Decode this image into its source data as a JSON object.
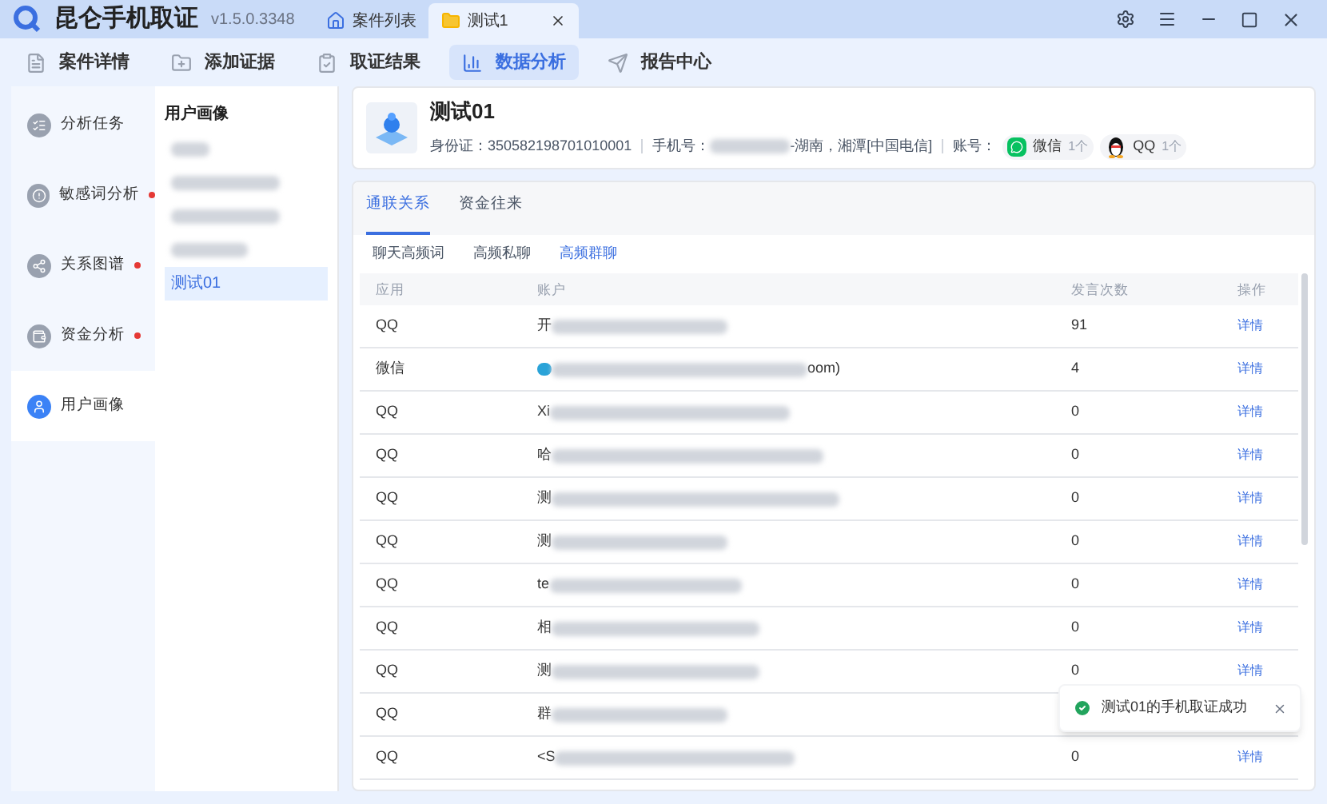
{
  "app": {
    "name": "昆仑手机取证",
    "version": "v1.5.0.3348"
  },
  "tabs": [
    {
      "label": "案件列表",
      "selected": false,
      "closable": false
    },
    {
      "label": "测试1",
      "selected": true,
      "closable": true
    }
  ],
  "toolbar": [
    {
      "label": "案件详情",
      "selected": false
    },
    {
      "label": "添加证据",
      "selected": false
    },
    {
      "label": "取证结果",
      "selected": false
    },
    {
      "label": "数据分析",
      "selected": true
    },
    {
      "label": "报告中心",
      "selected": false
    }
  ],
  "nav": [
    {
      "label": "分析任务",
      "dot": false,
      "selected": false
    },
    {
      "label": "敏感词分析",
      "dot": true,
      "selected": false
    },
    {
      "label": "关系图谱",
      "dot": true,
      "selected": false
    },
    {
      "label": "资金分析",
      "dot": true,
      "selected": false
    },
    {
      "label": "用户画像",
      "dot": false,
      "selected": true
    }
  ],
  "list": {
    "title": "用户画像",
    "items": [
      {
        "kind": "blurred",
        "selected": false
      },
      {
        "kind": "blurred",
        "selected": false
      },
      {
        "kind": "blurred",
        "selected": false
      },
      {
        "kind": "blurred",
        "selected": false
      },
      {
        "kind": "text",
        "label": "测试01",
        "selected": true
      }
    ]
  },
  "profile": {
    "name": "测试01",
    "id": "身份证：350582198701010001",
    "phone_label": "手机号：",
    "phone_suffix": "-湖南，湘潭[中国电信]",
    "account_label": "账号：",
    "accounts": [
      {
        "kind": "wechat",
        "name": "微信",
        "count": "1个"
      },
      {
        "kind": "qq",
        "name": "QQ",
        "count": "1个"
      }
    ]
  },
  "main_tabs": [
    {
      "label": "通联关系",
      "selected": true
    },
    {
      "label": "资金往来",
      "selected": false
    }
  ],
  "sub_tabs": [
    {
      "label": "聊天高频词",
      "selected": false
    },
    {
      "label": "高频私聊",
      "selected": false
    },
    {
      "label": "高频群聊",
      "selected": true
    }
  ],
  "table": {
    "columns": [
      "应用",
      "账户",
      "发言次数",
      "操作"
    ],
    "rows": [
      {
        "app": "QQ",
        "account": "开",
        "count": "91",
        "action": "详情"
      },
      {
        "app": "微信",
        "avatar": true,
        "account_tail": "oom)",
        "count": "4",
        "action": "详情"
      },
      {
        "app": "QQ",
        "account": "Xi",
        "count": "0",
        "action": "详情"
      },
      {
        "app": "QQ",
        "account": "哈",
        "count": "0",
        "action": "详情"
      },
      {
        "app": "QQ",
        "account": "测",
        "count": "0",
        "action": "详情"
      },
      {
        "app": "QQ",
        "account": "测",
        "count": "0",
        "action": "详情"
      },
      {
        "app": "QQ",
        "account": "te",
        "count": "0",
        "action": "详情"
      },
      {
        "app": "QQ",
        "account": "相",
        "count": "0",
        "action": "详情"
      },
      {
        "app": "QQ",
        "account": "测",
        "count": "0",
        "action": "详情"
      },
      {
        "app": "QQ",
        "account": "群"
      },
      {
        "app": "QQ",
        "account": "<S",
        "count": "0",
        "action": "详情"
      }
    ]
  },
  "toast": {
    "message": "测试01的手机取证成功"
  }
}
